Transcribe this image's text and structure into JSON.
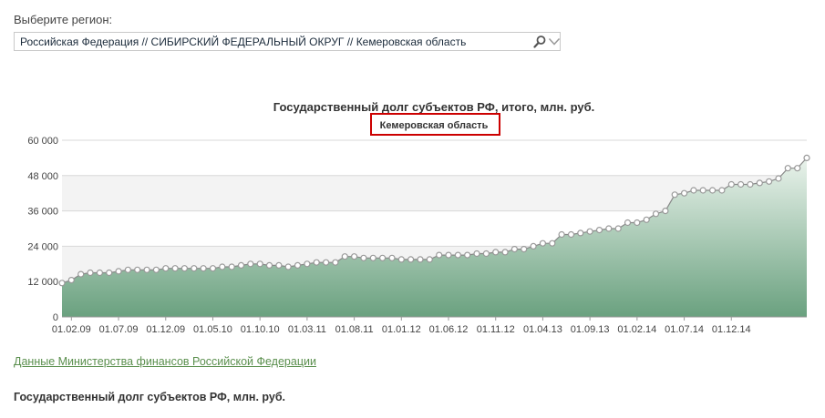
{
  "region": {
    "label": "Выберите регион:",
    "value": "Российская Федерация // СИБИРСКИЙ ФЕДЕРАЛЬНЫЙ ОКРУГ // Кемеровская область"
  },
  "link": {
    "text": "Данные Министерства финансов Российской Федерации"
  },
  "bottom_title": "Государственный долг субъектов РФ, млн. руб.",
  "colors": {
    "accent_green": "#5a8f4d",
    "highlight_border": "#cc0000",
    "area_fill_dark": "#6aa17f"
  },
  "chart_data": {
    "type": "area",
    "title": "Государственный долг субъектов РФ, итого, млн. руб.",
    "subtitle": "Кемеровская область",
    "xlabel": "",
    "ylabel": "",
    "ylim": [
      0,
      60000
    ],
    "yticks": [
      "0",
      "12 000",
      "24 000",
      "36 000",
      "48 000",
      "60 000"
    ],
    "xticks": [
      "01.02.09",
      "01.07.09",
      "01.12.09",
      "01.05.10",
      "01.10.10",
      "01.03.11",
      "01.08.11",
      "01.01.12",
      "01.06.12",
      "01.11.12",
      "01.04.13",
      "01.09.13",
      "01.02.14",
      "01.07.14",
      "01.12.14"
    ],
    "grid": true,
    "legend": "none",
    "x_start": "01.01.09",
    "series": [
      {
        "values": [
          11500,
          12500,
          14500,
          15000,
          15000,
          15000,
          15500,
          16000,
          16000,
          16000,
          16000,
          16500,
          16500,
          16500,
          16500,
          16500,
          16500,
          17000,
          17000,
          17500,
          18000,
          18000,
          17500,
          17500,
          17000,
          17500,
          18000,
          18500,
          18500,
          18500,
          20500,
          20500,
          20000,
          20000,
          20000,
          20000,
          19500,
          19500,
          19500,
          19500,
          21000,
          21000,
          21000,
          21000,
          21500,
          21500,
          22000,
          22000,
          23000,
          23000,
          24000,
          25000,
          25000,
          28000,
          28000,
          28500,
          29000,
          29500,
          30000,
          30000,
          32000,
          32000,
          33000,
          35000,
          36000,
          41500,
          42000,
          43000,
          43000,
          43000,
          43000,
          45000,
          45000,
          45000,
          45500,
          46000,
          47000,
          50500,
          50500,
          54000
        ]
      }
    ]
  }
}
